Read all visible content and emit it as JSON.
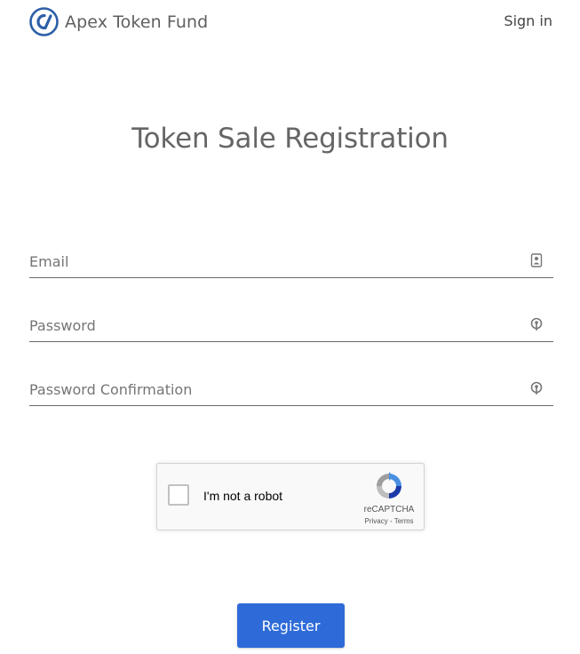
{
  "header": {
    "brand": "Apex Token Fund",
    "signin_label": "Sign in",
    "logo_icon": "apex-logo",
    "brand_color": "#2c5fa8"
  },
  "page": {
    "title": "Token Sale Registration"
  },
  "form": {
    "email": {
      "placeholder": "Email",
      "value": "",
      "icon": "contact-card-icon"
    },
    "password": {
      "placeholder": "Password",
      "value": "",
      "icon": "key-icon"
    },
    "password_confirmation": {
      "placeholder": "Password Confirmation",
      "value": "",
      "icon": "key-icon"
    }
  },
  "recaptcha": {
    "label": "I'm not a robot",
    "brand": "reCAPTCHA",
    "privacy": "Privacy",
    "separator": " - ",
    "terms": "Terms",
    "checked": false
  },
  "actions": {
    "register_label": "Register",
    "register_color": "#2e6bd9"
  }
}
